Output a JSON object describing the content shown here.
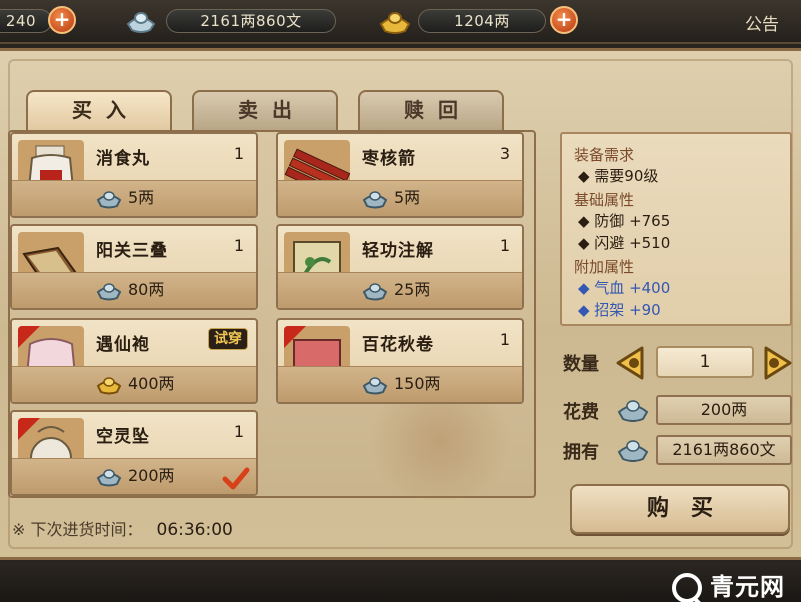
{
  "topbar": {
    "res1_value": "240",
    "res2_value": "2161两860文",
    "res3_value": "1204两",
    "notice_label": "公告"
  },
  "tabs": [
    {
      "label": "买入",
      "active": true
    },
    {
      "label": "卖出",
      "active": false
    },
    {
      "label": "赎回",
      "active": false
    }
  ],
  "items": [
    {
      "name": "消食丸",
      "count": "1",
      "price": "5两",
      "currency": "silver"
    },
    {
      "name": "枣核箭",
      "count": "3",
      "price": "5两",
      "currency": "silver"
    },
    {
      "name": "阳关三叠",
      "count": "1",
      "price": "80两",
      "currency": "silver"
    },
    {
      "name": "轻功注解",
      "count": "1",
      "price": "25两",
      "currency": "silver"
    },
    {
      "name": "遇仙袍",
      "count": "",
      "badge": "试穿",
      "price": "400两",
      "currency": "gold"
    },
    {
      "name": "百花秋卷",
      "count": "1",
      "price": "150两",
      "currency": "silver"
    },
    {
      "name": "空灵坠",
      "count": "1",
      "price": "200两",
      "currency": "silver",
      "checked": true
    }
  ],
  "restock": {
    "label": "※ 下次进货时间：",
    "time": "06:36:00"
  },
  "info": {
    "req_header": "装备需求",
    "req_rows": [
      "◆ 需要90级"
    ],
    "base_header": "基础属性",
    "base_rows": [
      "◆ 防御  +765",
      "◆ 闪避  +510"
    ],
    "extra_header": "附加属性",
    "extra_rows": [
      "◆ 气血  +400",
      "◆ 招架  +90"
    ]
  },
  "controls": {
    "qty_label": "数量",
    "qty_value": "1",
    "cost_label": "花费",
    "cost_value": "200两",
    "own_label": "拥有",
    "own_value": "2161两860文",
    "buy_label": "购买"
  },
  "watermark": "青元网",
  "colors": {
    "accent": "#b63a12",
    "parchment": "#d7c49f",
    "border": "#8c6f4a",
    "blue_stat": "#3357b3"
  }
}
